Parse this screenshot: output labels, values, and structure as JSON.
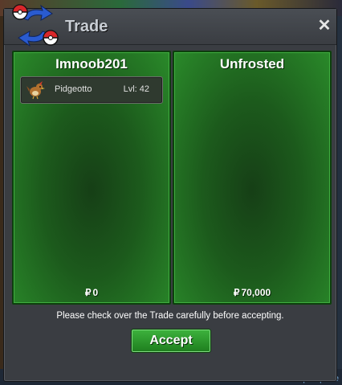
{
  "window": {
    "title": "Trade",
    "close_glyph": "✕"
  },
  "trade": {
    "left": {
      "player_name": "Imnoob201",
      "money_symbol": "₽",
      "money_amount": "0",
      "items": [
        {
          "name": "Pidgeotto",
          "level": "Lvl: 42",
          "icon": "pidgeotto-sprite-icon"
        }
      ]
    },
    "right": {
      "player_name": "Unfrosted",
      "money_symbol": "₽",
      "money_amount": "70,000",
      "items": []
    }
  },
  "footer": {
    "notice": "Please check over the Trade carefully before accepting.",
    "accept_label": "Accept"
  },
  "background": {
    "link_fragment": "https://poke"
  },
  "colors": {
    "panel_green": "#1c5a1c",
    "panel_border": "#3fae3f",
    "button_green": "#2e9a2e",
    "window_bg": "#3a3d42",
    "title_text": "#c8cdd4"
  },
  "icons": {
    "title_logo": "trade-arrows-pokeball-icon",
    "close": "close-icon"
  }
}
